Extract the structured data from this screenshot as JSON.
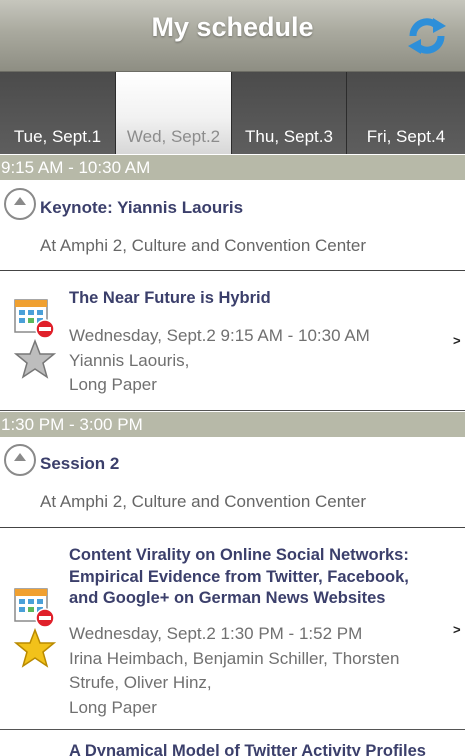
{
  "header": {
    "title": "My schedule",
    "refresh_icon": "refresh-icon"
  },
  "tabs": [
    {
      "label": "Tue, Sept.1",
      "active": false
    },
    {
      "label": "Wed, Sept.2",
      "active": true
    },
    {
      "label": "Thu, Sept.3",
      "active": false
    },
    {
      "label": "Fri, Sept.4",
      "active": false
    }
  ],
  "slots": [
    {
      "time": "9:15 AM - 10:30 AM",
      "group": {
        "title": "Keynote: Yiannis Laouris",
        "location": "At Amphi 2, Culture and Convention Center"
      },
      "talk": {
        "title": "The Near Future is Hybrid",
        "time": "Wednesday, Sept.2 9:15 AM - 10:30 AM",
        "authors": "Yiannis Laouris,",
        "type": "Long Paper",
        "starred": false
      }
    },
    {
      "time": "1:30 PM - 3:00 PM",
      "group": {
        "title": "Session 2",
        "location": "At Amphi 2, Culture and Convention Center"
      },
      "talk": {
        "title": "Content Virality on Online Social Networks: Empirical Evidence from Twitter, Facebook, and Google+ on German News Websites",
        "time": "Wednesday, Sept.2 1:30 PM - 1:52 PM",
        "authors": "Irina Heimbach, Benjamin Schiller, Thorsten Strufe, Oliver Hinz,",
        "type": "Long Paper",
        "starred": true
      }
    }
  ],
  "chevron": ">",
  "next_item_partial": "A Dynamical Model of Twitter Activity Profiles",
  "colors": {
    "accent_text": "#3b3f6b",
    "slot_bar": "#b7b9a8",
    "star_gold": "#f2c21a",
    "refresh_blue": "#2e8fd9"
  }
}
